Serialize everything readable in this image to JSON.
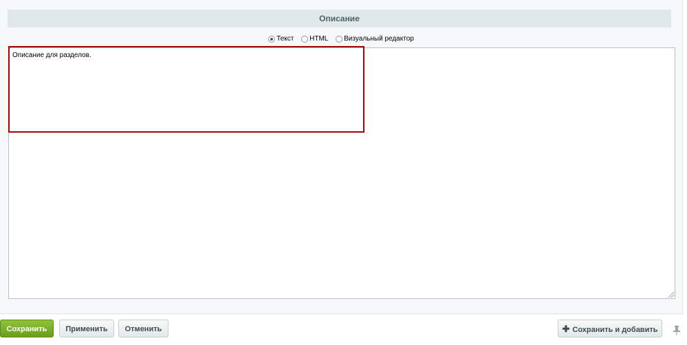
{
  "section": {
    "title": "Описание"
  },
  "mode": {
    "options": [
      "Текст",
      "HTML",
      "Визуальный редактор"
    ],
    "selected": "Текст"
  },
  "editor": {
    "value": "Описание для разделов."
  },
  "buttons": {
    "save": "Сохранить",
    "apply": "Применить",
    "cancel": "Отменить",
    "save_add": "Сохранить и добавить",
    "save_add_icon": "plus-icon"
  },
  "pin_icon": "pin-icon",
  "colors": {
    "save_button": "#79b128",
    "highlight": "#a80000"
  }
}
